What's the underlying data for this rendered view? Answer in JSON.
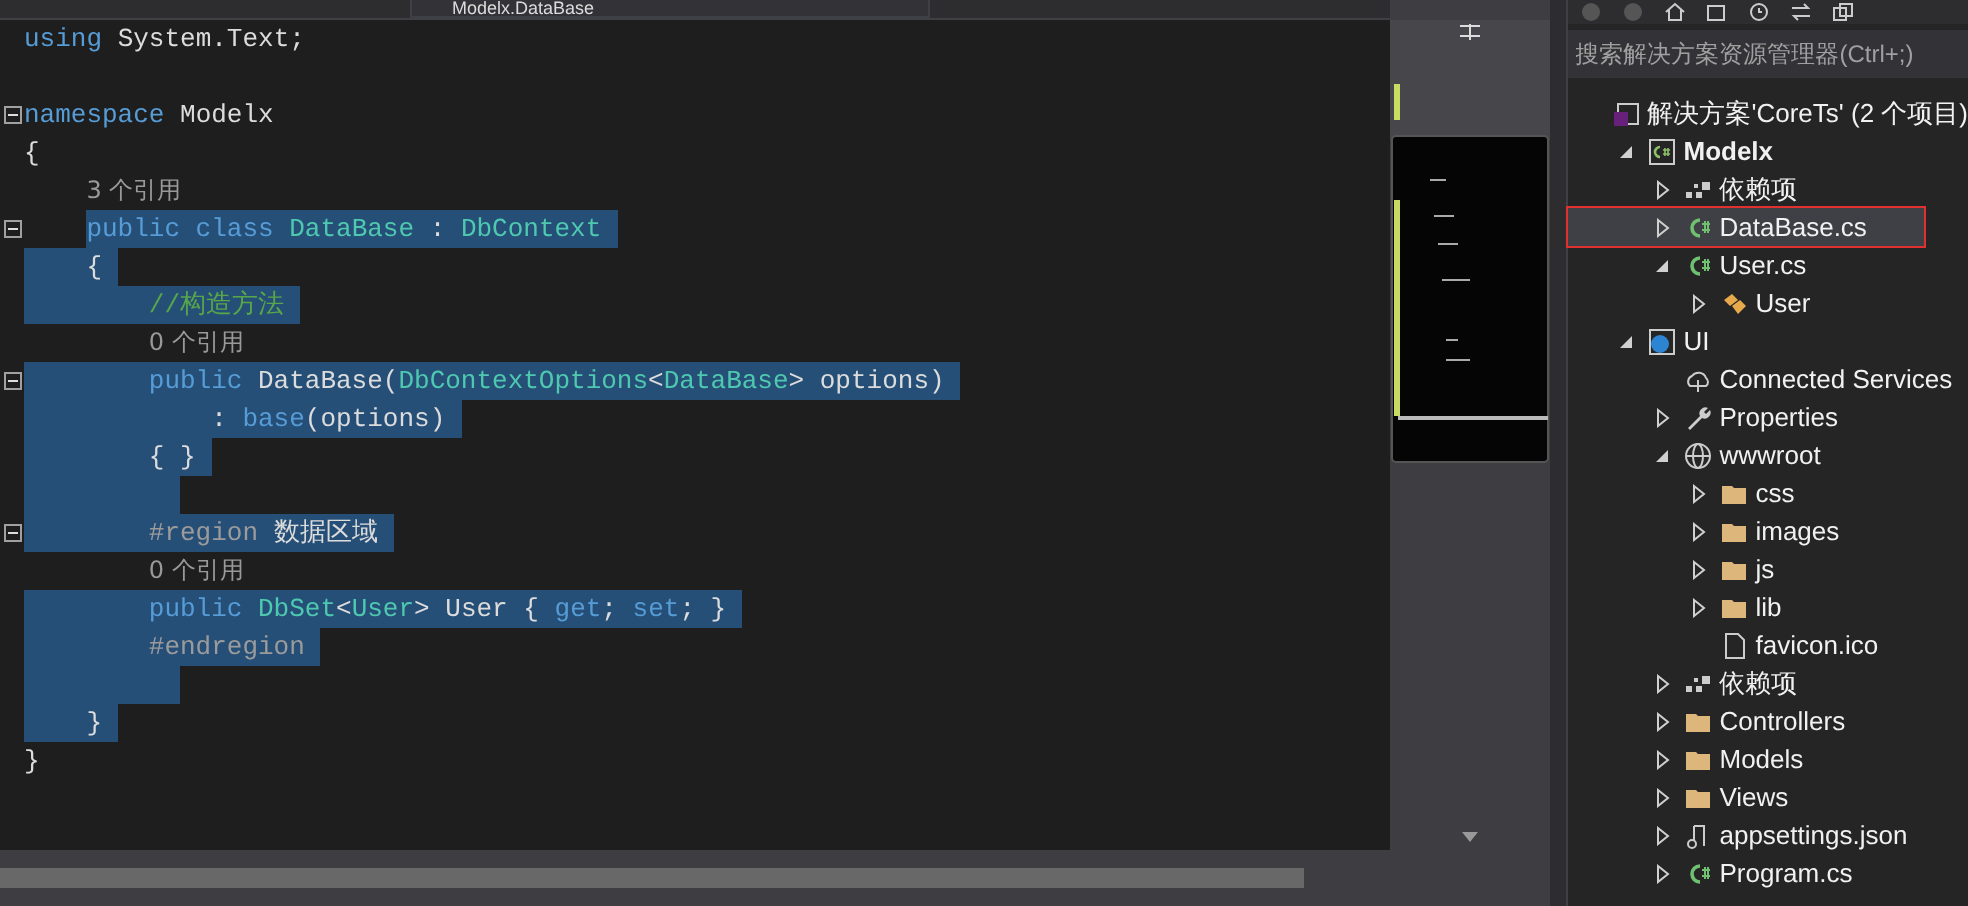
{
  "editor": {
    "nav_member": "Modelx.DataBase",
    "lines": [
      {
        "selected": false,
        "tokens": [
          {
            "kind": "kw",
            "text": "using "
          },
          {
            "kind": "plain",
            "text": "System.Text;"
          }
        ]
      },
      {
        "selected": false
      },
      {
        "selected": false,
        "fold": true,
        "tokens": [
          {
            "kind": "kw",
            "text": "namespace "
          },
          {
            "kind": "plain",
            "text": "Modelx"
          }
        ]
      },
      {
        "selected": false,
        "tokens": [
          {
            "kind": "plain",
            "text": "{"
          }
        ],
        "children": [
          {
            "tokens": [
              {
                "kind": "lens",
                "text": "3 个引用"
              }
            ]
          },
          {
            "selected": true,
            "fold": true,
            "tokens": [
              {
                "kind": "kw",
                "text": "public class "
              },
              {
                "kind": "type",
                "text": "DataBase"
              },
              {
                "kind": "plain",
                "text": " : "
              },
              {
                "kind": "type",
                "text": "DbContext"
              }
            ]
          },
          {
            "selected": true,
            "tokens": [
              {
                "kind": "plain",
                "text": "{"
              }
            ],
            "children": [
              {
                "selected": true,
                "tokens": [
                  {
                    "kind": "comment",
                    "text": "//构造方法"
                  }
                ]
              },
              {
                "tokens": [
                  {
                    "kind": "lens",
                    "text": "0 个引用"
                  }
                ]
              },
              {
                "selected": true,
                "fold": true,
                "tokens": [
                  {
                    "kind": "kw",
                    "text": "public "
                  },
                  {
                    "kind": "plain",
                    "text": "DataBase("
                  },
                  {
                    "kind": "type",
                    "text": "DbContextOptions"
                  },
                  {
                    "kind": "plain",
                    "text": "<"
                  },
                  {
                    "kind": "type",
                    "text": "DataBase"
                  },
                  {
                    "kind": "plain",
                    "text": "> options)"
                  }
                ],
                "children": [
                  {
                    "selected": true,
                    "tokens": [
                      {
                        "kind": "plain",
                        "text": ": "
                      },
                      {
                        "kind": "kw",
                        "text": "base"
                      },
                      {
                        "kind": "plain",
                        "text": "(options)"
                      }
                    ]
                  }
                ]
              },
              {
                "selected": true,
                "tokens": [
                  {
                    "kind": "plain",
                    "text": "{ }"
                  }
                ]
              },
              {
                "selected": true
              },
              {
                "selected": true,
                "fold": true,
                "tokens": [
                  {
                    "kind": "pp",
                    "text": "#region "
                  },
                  {
                    "kind": "plain",
                    "text": "数据区域"
                  }
                ]
              },
              {
                "tokens": [
                  {
                    "kind": "lens",
                    "text": "0 个引用"
                  }
                ]
              },
              {
                "selected": true,
                "tokens": [
                  {
                    "kind": "kw",
                    "text": "public "
                  },
                  {
                    "kind": "type",
                    "text": "DbSet"
                  },
                  {
                    "kind": "plain",
                    "text": "<"
                  },
                  {
                    "kind": "type",
                    "text": "User"
                  },
                  {
                    "kind": "plain",
                    "text": "> User { "
                  },
                  {
                    "kind": "kw",
                    "text": "get"
                  },
                  {
                    "kind": "plain",
                    "text": "; "
                  },
                  {
                    "kind": "kw",
                    "text": "set"
                  },
                  {
                    "kind": "plain",
                    "text": "; }"
                  }
                ]
              },
              {
                "selected": true,
                "tokens": [
                  {
                    "kind": "pp",
                    "text": "#endregion"
                  }
                ]
              },
              {
                "selected": true
              }
            ]
          },
          {
            "selected": true,
            "tokens": [
              {
                "kind": "plain",
                "text": "}"
              }
            ]
          }
        ]
      },
      {
        "selected": false,
        "tokens": [
          {
            "kind": "plain",
            "text": "}"
          }
        ]
      }
    ]
  },
  "solution_explorer": {
    "search": {
      "placeholder": "搜索解决方案资源管理器(Ctrl+;)"
    },
    "tree": [
      {
        "label": "解决方案'CoreTs' (2 个项目)",
        "kind": "solution",
        "selected": false,
        "children": [
          {
            "label": "Modelx",
            "kind": "csproj",
            "bold": true,
            "expanded": true,
            "selected": false,
            "children": [
              {
                "label": "依赖项",
                "kind": "deps",
                "expanded": false,
                "selected": false
              },
              {
                "label": "DataBase.cs",
                "kind": "cs",
                "expanded": false,
                "selected": true
              },
              {
                "label": "User.cs",
                "kind": "cs",
                "expanded": true,
                "selected": false,
                "children": [
                  {
                    "label": "User",
                    "kind": "class",
                    "expanded": false,
                    "selected": false
                  }
                ]
              }
            ]
          },
          {
            "label": "UI",
            "kind": "webproj",
            "expanded": true,
            "selected": false,
            "children": [
              {
                "label": "Connected Services",
                "kind": "cloud",
                "selected": false
              },
              {
                "label": "Properties",
                "kind": "wrench",
                "expanded": false,
                "selected": false
              },
              {
                "label": "wwwroot",
                "kind": "globe",
                "expanded": true,
                "selected": false,
                "children": [
                  {
                    "label": "css",
                    "kind": "folder",
                    "expanded": false,
                    "selected": false
                  },
                  {
                    "label": "images",
                    "kind": "folder",
                    "expanded": false,
                    "selected": false
                  },
                  {
                    "label": "js",
                    "kind": "folder",
                    "expanded": false,
                    "selected": false
                  },
                  {
                    "label": "lib",
                    "kind": "folder",
                    "expanded": false,
                    "selected": false
                  },
                  {
                    "label": "favicon.ico",
                    "kind": "file",
                    "selected": false
                  }
                ]
              },
              {
                "label": "依赖项",
                "kind": "deps",
                "expanded": false,
                "selected": false
              },
              {
                "label": "Controllers",
                "kind": "folder",
                "expanded": false,
                "selected": false
              },
              {
                "label": "Models",
                "kind": "folder",
                "expanded": false,
                "selected": false
              },
              {
                "label": "Views",
                "kind": "folder",
                "expanded": false,
                "selected": false
              },
              {
                "label": "appsettings.json",
                "kind": "json",
                "expanded": false,
                "selected": false
              },
              {
                "label": "Program.cs",
                "kind": "cs",
                "expanded": false,
                "selected": false
              }
            ]
          }
        ]
      }
    ]
  }
}
